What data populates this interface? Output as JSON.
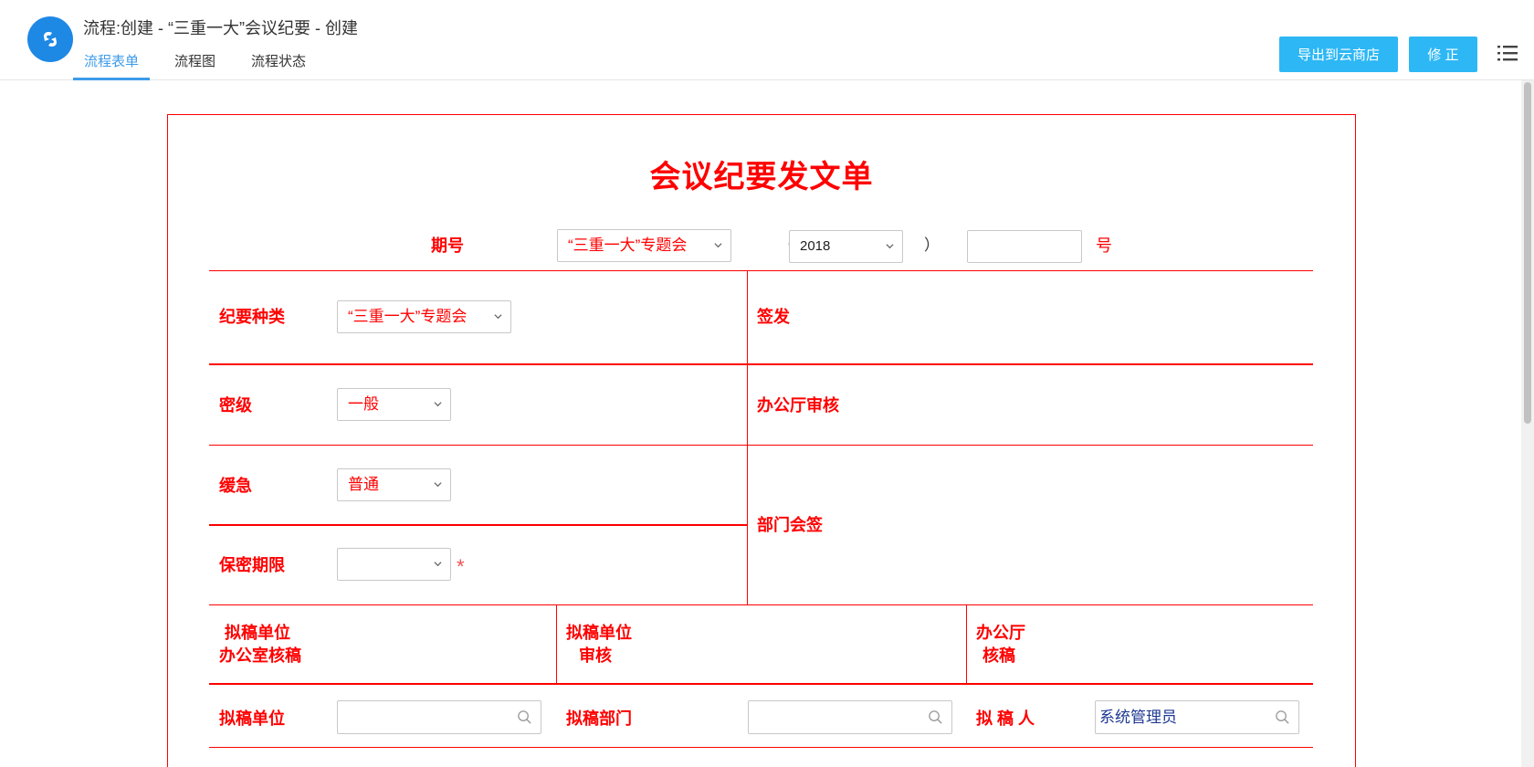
{
  "header": {
    "title": "流程:创建 - “三重一大”会议纪要 - 创建",
    "tabs": [
      "流程表单",
      "流程图",
      "流程状态"
    ],
    "export_label": "导出到云商店",
    "fix_label": "修 正"
  },
  "form": {
    "title": "会议纪要发文单",
    "issue": {
      "label": "期号",
      "type_value": "“三重一大”专题会",
      "paren_open": "（",
      "year_value": "2018",
      "paren_close": "）",
      "number_value": "",
      "number_suffix": "号"
    },
    "summary_type": {
      "label": "纪要种类",
      "value": "“三重一大”专题会"
    },
    "sign_off": {
      "label": "签发"
    },
    "secret_level": {
      "label": "密级",
      "value": "一般"
    },
    "office_review": {
      "label": "办公厅审核"
    },
    "urgency": {
      "label": "缓急",
      "value": "普通"
    },
    "dept_countersign": {
      "label": "部门会签"
    },
    "secret_period": {
      "label": "保密期限",
      "value": "",
      "required_mark": "*"
    },
    "draft_office_review": {
      "label_line1": "拟稿单位",
      "label_line2": "办公室核稿"
    },
    "draft_unit_review": {
      "label_line1": "拟稿单位",
      "label_line2": "审核"
    },
    "general_office_review": {
      "label_line1": "办公厅",
      "label_line2": "核稿"
    },
    "draft_unit": {
      "label": "拟稿单位",
      "value": ""
    },
    "draft_dept": {
      "label": "拟稿部门",
      "value": ""
    },
    "drafter": {
      "label": "拟 稿 人",
      "value": "系统管理员"
    }
  },
  "colors": {
    "accent_red": "#ff0000",
    "button_blue": "#2db7f5",
    "tab_active": "#3d9be9",
    "logo_blue": "#1e88e5",
    "drafter_text": "#1f3a93"
  },
  "icons": [
    "app-logo-icon",
    "menu-list-icon",
    "chevron-down-icon",
    "search-icon"
  ]
}
